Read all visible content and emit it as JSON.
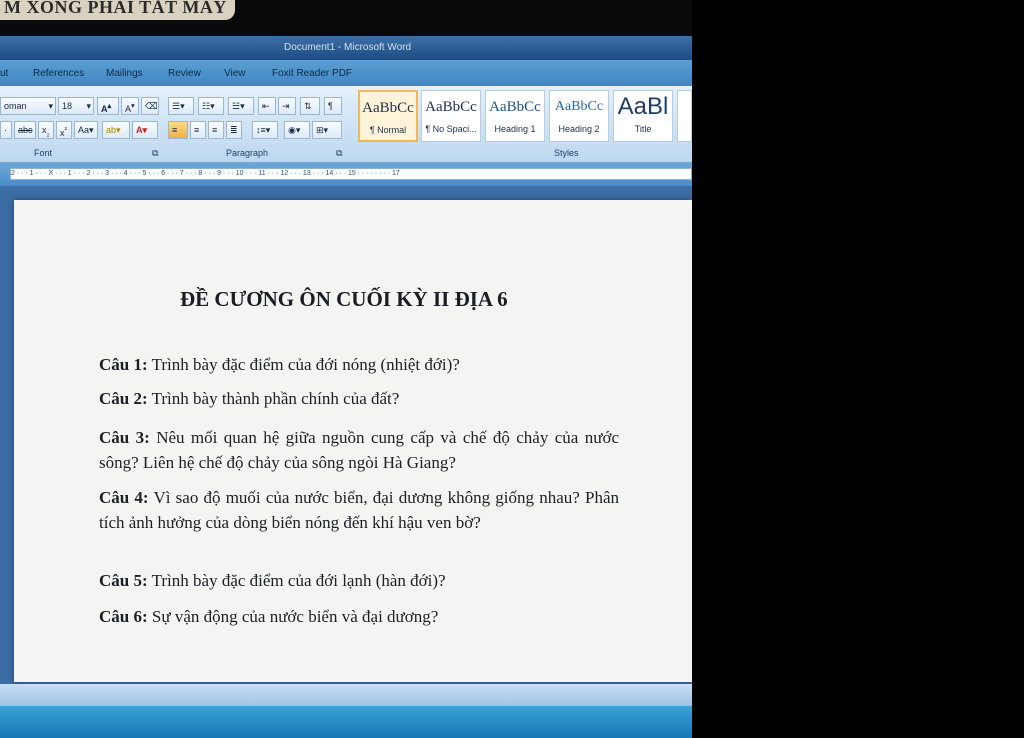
{
  "photo_caption": "M XONG PHẢI TẮT MÁY",
  "window": {
    "title": "Document1 - Microsoft Word"
  },
  "ribbon_tabs": [
    "ut",
    "References",
    "Mailings",
    "Review",
    "View",
    "Foxit Reader PDF"
  ],
  "font_group": {
    "font_name": "oman",
    "font_size": "18",
    "label": "Font"
  },
  "paragraph_group": {
    "label": "Paragraph"
  },
  "styles_group": {
    "label": "Styles",
    "styles": [
      {
        "sample": "AaBbCc",
        "name": "¶ Normal",
        "selected": true
      },
      {
        "sample": "AaBbCc",
        "name": "¶ No Spaci...",
        "selected": false
      },
      {
        "sample": "AaBbCc",
        "name": "Heading 1",
        "selected": false
      },
      {
        "sample": "AaBbCc",
        "name": "Heading 2",
        "selected": false
      },
      {
        "sample": "AaBl",
        "name": "Title",
        "selected": false
      }
    ]
  },
  "ruler": "2 · · · 1 · · · X · · · 1 · · · 2 · · · 3 · · · 4 · · · 5 · · · 6 · · · 7 · · · 8 · · · 9 · · · 10 · · · 11 · · · 12 · · · 13 · · · 14 · · · 15 · · · · · · · · 17",
  "document": {
    "title": "ĐỀ CƯƠNG ÔN CUỐI KỲ II ĐỊA 6",
    "questions": [
      {
        "label": "Câu 1:",
        "text": " Trình bày đặc điểm của đới nóng (nhiệt đới)?"
      },
      {
        "label": "Câu 2:",
        "text": " Trình bày thành phần chính của đất?"
      },
      {
        "label": "Câu 3:",
        "text": "  Nêu mối quan hệ giữa nguồn cung cấp và chế độ chảy của nước sông? Liên hệ chế độ chảy của sông ngòi Hà Giang?"
      },
      {
        "label": "Câu 4:",
        "text": "  Vì sao độ muối của nước biển, đại dương không giống nhau? Phân tích ảnh hưởng của dòng biển nóng đến khí hậu ven bờ?"
      },
      {
        "label": "Câu 5:",
        "text": " Trình bày đặc điểm của đới lạnh (hàn đới)?"
      },
      {
        "label": "Câu 6:",
        "text": "  Sự vận động của nước biển và đại dương?"
      }
    ]
  }
}
